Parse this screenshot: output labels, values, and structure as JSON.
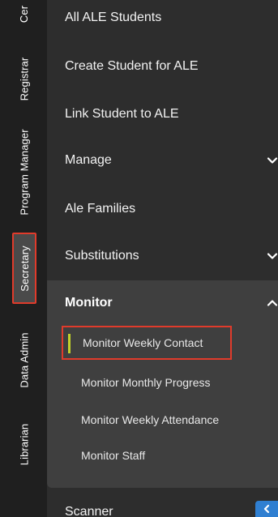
{
  "rail": {
    "tabs": [
      {
        "label": "Cer"
      },
      {
        "label": "Registrar"
      },
      {
        "label": "Program Manager"
      },
      {
        "label": "Secretary",
        "selected": true
      },
      {
        "label": "Data Admin"
      },
      {
        "label": "Librarian"
      }
    ]
  },
  "menu": {
    "items": [
      {
        "label": "All ALE Students"
      },
      {
        "label": "Create Student for ALE"
      },
      {
        "label": "Link Student to ALE"
      },
      {
        "label": "Manage",
        "icon": "chevron-down-icon"
      },
      {
        "label": "Ale Families"
      },
      {
        "label": "Substitutions",
        "icon": "chevron-down-icon"
      }
    ],
    "monitor": {
      "label": "Monitor",
      "icon": "chevron-up-icon",
      "items": [
        {
          "label": "Monitor Weekly Contact",
          "active": true
        },
        {
          "label": "Monitor Monthly Progress"
        },
        {
          "label": "Monitor Weekly Attendance"
        },
        {
          "label": "Monitor Staff"
        }
      ]
    },
    "after": [
      {
        "label": "Scanner"
      }
    ]
  },
  "colors": {
    "rail_bg": "#1f1f1f",
    "menu_bg": "#2d2d2d",
    "group_bg": "#3f3f3f",
    "highlight_border": "#e03b2b",
    "active_indicator": "#c3d12a",
    "collapse_button": "#2f7fd1"
  },
  "collapse_button": {
    "icon": "chevron-left-icon"
  }
}
